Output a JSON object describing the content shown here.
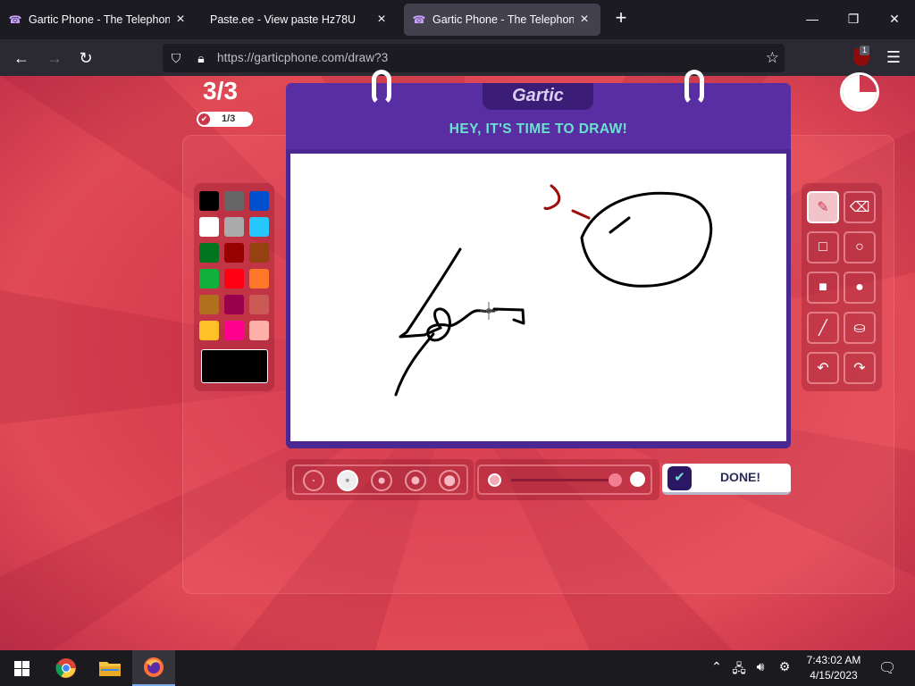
{
  "browser": {
    "tabs": [
      {
        "title": "Gartic Phone - The Telephone G",
        "active": false,
        "favicon": "phone-icon"
      },
      {
        "title": "Paste.ee - View paste Hz78U",
        "active": false,
        "favicon": "none"
      },
      {
        "title": "Gartic Phone - The Telephone G",
        "active": true,
        "favicon": "phone-icon"
      }
    ],
    "url": "https://garticphone.com/draw?3",
    "extension_badge": "1"
  },
  "game": {
    "round": "3/3",
    "progress": "1/3",
    "logo": "Gartic",
    "prompt": "HEY, IT'S TIME TO DRAW!",
    "done_label": "DONE!",
    "timer_elapsed_fraction": 0.25,
    "palette": [
      "#000000",
      "#666666",
      "#0050cd",
      "#ffffff",
      "#aaaaaa",
      "#26c9ff",
      "#017420",
      "#990000",
      "#964112",
      "#11b03c",
      "#ff0013",
      "#ff7829",
      "#b0701c",
      "#99004e",
      "#cb5a57",
      "#ffc126",
      "#ff008f",
      "#feafa8"
    ],
    "selected_color": "#000000",
    "tools": [
      "pencil-icon",
      "eraser-icon",
      "rectangle-outline-icon",
      "ellipse-outline-icon",
      "rectangle-fill-icon",
      "ellipse-fill-icon",
      "line-icon",
      "bucket-icon",
      "undo-icon",
      "redo-icon"
    ],
    "active_tool": "pencil-icon",
    "brush_sizes": 5,
    "selected_brush": 2
  },
  "taskbar": {
    "time": "7:43:02 AM",
    "date": "4/15/2023"
  }
}
